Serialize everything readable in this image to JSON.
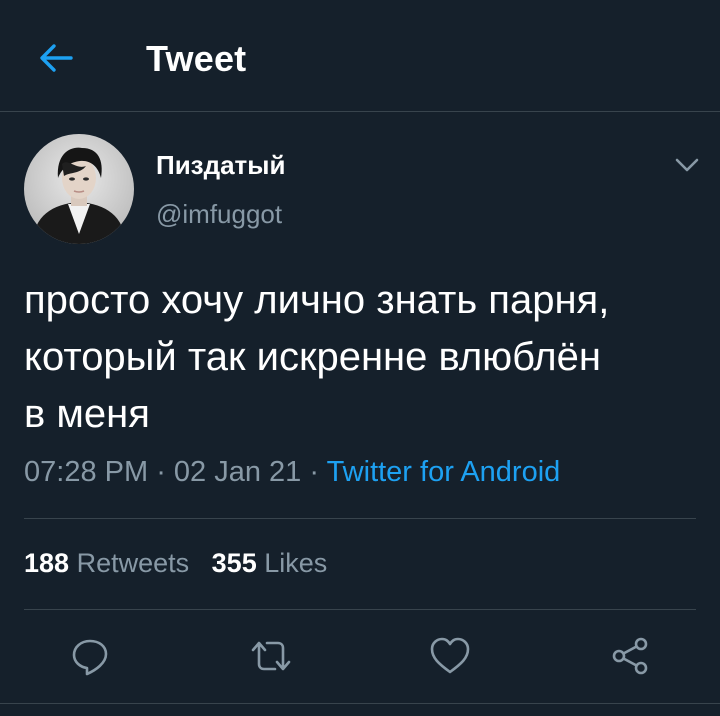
{
  "header": {
    "title": "Tweet",
    "back_icon": "arrow-left-icon"
  },
  "author": {
    "display_name": "Пиздатый",
    "handle": "@imfuggot",
    "menu_icon": "chevron-down-icon"
  },
  "tweet": {
    "text": "просто хочу лично знать парня,\nкоторый так искренне влюблён\nв меня",
    "time": "07:28 PM",
    "date": "02 Jan 21",
    "source": "Twitter for Android",
    "separator": " · "
  },
  "stats": {
    "retweets_count": "188",
    "retweets_label": "Retweets",
    "likes_count": "355",
    "likes_label": "Likes"
  },
  "actions": {
    "reply_icon": "reply-icon",
    "retweet_icon": "retweet-icon",
    "like_icon": "heart-icon",
    "share_icon": "share-icon"
  },
  "colors": {
    "background": "#15202b",
    "accent": "#1da1f2",
    "secondary_text": "#8899a6",
    "divider": "#38444d"
  }
}
